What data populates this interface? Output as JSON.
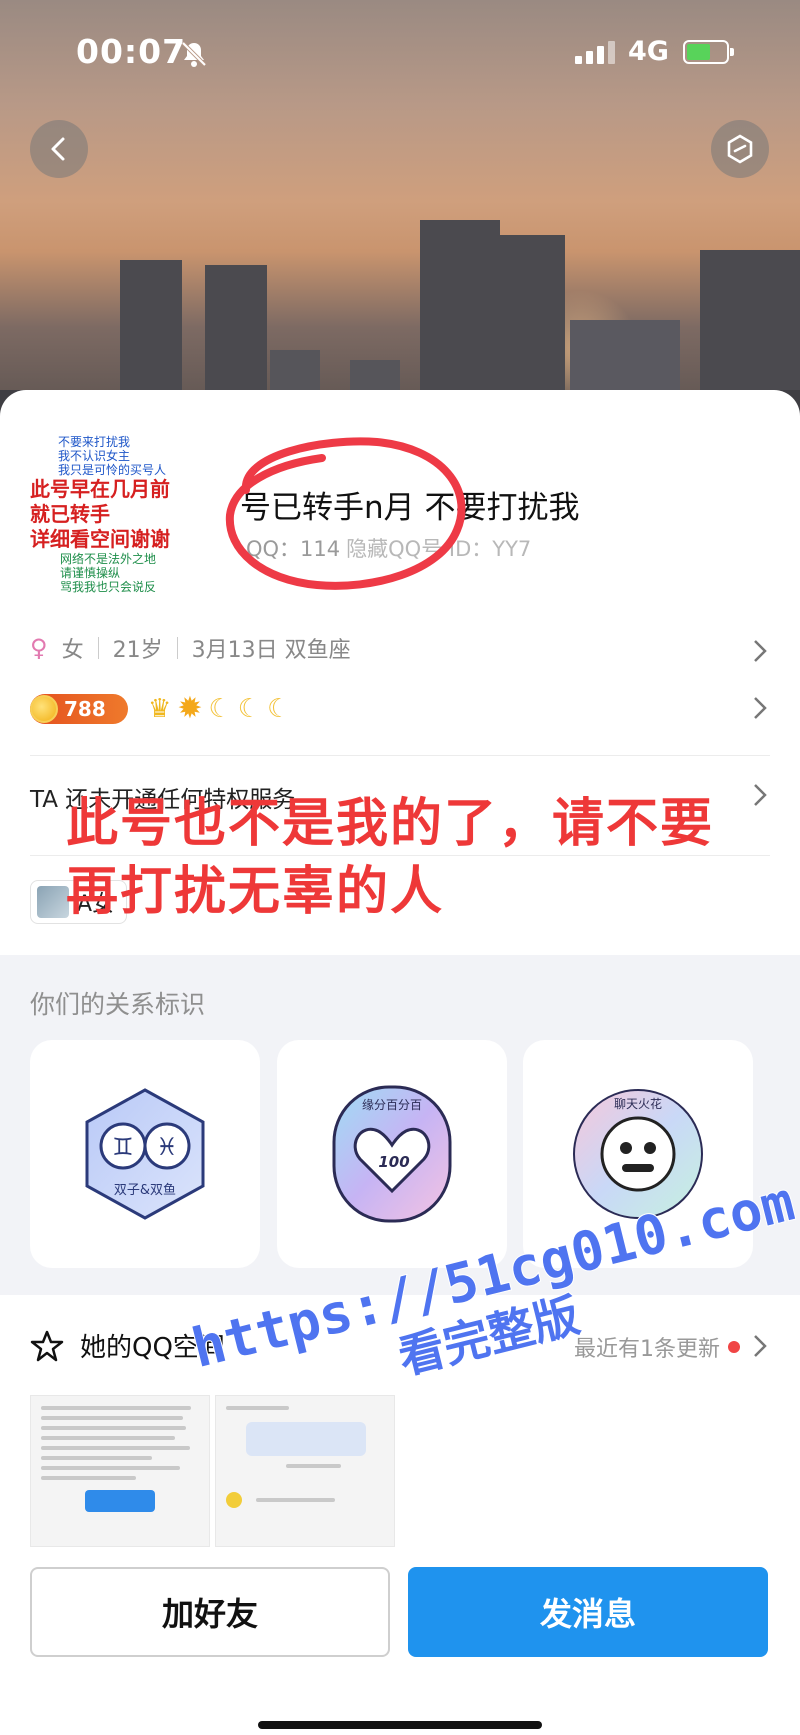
{
  "status_bar": {
    "time": "00:07",
    "network": "4G"
  },
  "profile": {
    "nickname": "号已转手n月 不要打扰我",
    "qq_line": "QQ：114",
    "qq_line_blur": "隐藏QQ号 ID：YY7",
    "gender": "女",
    "age": "21岁",
    "birthday": "3月13日 双鱼座",
    "coin_count": "788",
    "privilege_text": "TA 还未开通任何特权服务",
    "tag_text": "A女"
  },
  "avatar_text": {
    "small_lines": [
      "不要来打扰我",
      "我不认识女主",
      "我只是可怜的买号人"
    ],
    "red_lines": [
      "此号早在几月前",
      "就已转手",
      "详细看空间谢谢"
    ],
    "green_lines": [
      "网络不是法外之地",
      "请谨慎操纵",
      "骂我我也只会说反"
    ]
  },
  "overlay_text": "此号也不是我的了，请不要再打扰无辜的人",
  "relationship": {
    "title": "你们的关系标识",
    "badges": [
      {
        "name": "zodiac-badge",
        "label": "双子&双鱼"
      },
      {
        "name": "fate-badge",
        "label": "缘分百分百",
        "score": "100"
      },
      {
        "name": "chat-badge",
        "label": "聊天火花"
      }
    ]
  },
  "qzone": {
    "title": "她的QQ空间",
    "recent": "最近有1条更新"
  },
  "watermark": {
    "url": "https://51cg010.com",
    "caption": "看完整版"
  },
  "buttons": {
    "add_friend": "加好友",
    "send_message": "发消息"
  },
  "colors": {
    "accent": "#1f93ee",
    "alert_red": "#ee3838",
    "watermark_blue": "#4f74f0"
  }
}
